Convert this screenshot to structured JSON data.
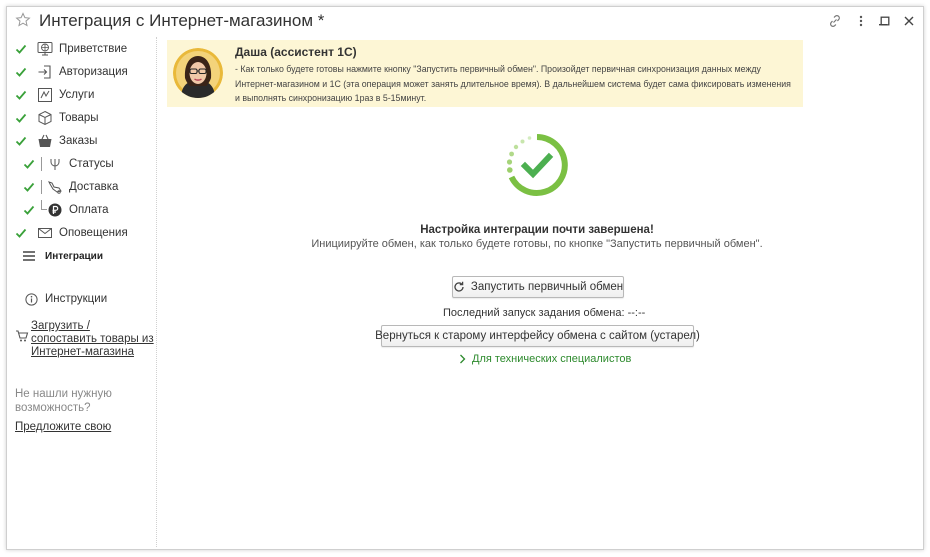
{
  "window": {
    "title": "Интеграция с Интернет-магазином *"
  },
  "sidebar": {
    "items": [
      {
        "label": "Приветствие",
        "icon": "globe-monitor-icon",
        "checked": true
      },
      {
        "label": "Авторизация",
        "icon": "login-icon",
        "checked": true
      },
      {
        "label": "Услуги",
        "icon": "services-icon",
        "checked": true
      },
      {
        "label": "Товары",
        "icon": "box-icon",
        "checked": true
      },
      {
        "label": "Заказы",
        "icon": "basket-icon",
        "checked": true
      },
      {
        "label": "Статусы",
        "icon": "fork-icon",
        "checked": true
      },
      {
        "label": "Доставка",
        "icon": "delivery-icon",
        "checked": true
      },
      {
        "label": "Оплата",
        "icon": "ruble-icon",
        "checked": true
      },
      {
        "label": "Оповещения",
        "icon": "envelope-icon",
        "checked": true
      },
      {
        "label": "Интеграции",
        "icon": "menu-icon",
        "checked": false
      }
    ],
    "instructions": "Инструкции",
    "load_link": [
      "Загрузить /",
      "сопоставить товары из",
      "Интернет-магазина"
    ],
    "not_found": [
      "Не нашли нужную",
      "возможность?"
    ],
    "suggest_link": "Предложите свою"
  },
  "assistant": {
    "name": "Даша (ассистент 1С)",
    "message": "- Как только будете готовы нажмите кнопку \"Запустить первичный обмен\". Произойдет первичная синхронизация данных между Интернет-магазином и 1С (эта операция может занять длительное время). В дальнейшем система будет сама фиксировать изменения и выполнять синхронизацию 1раз в 5-15минут."
  },
  "main": {
    "status_title": "Настройка интеграции почти завершена!",
    "status_subtitle": "Инициируйте обмен, как только будете готовы, по кнопке \"Запустить первичный обмен\".",
    "start_button": "Запустить первичный обмен",
    "last_run": "Последний запуск задания обмена: --:--",
    "old_interface_button": "Вернуться к старому интерфейсу обмена с сайтом (устарел)",
    "tech_link": "Для технических специалистов"
  },
  "colors": {
    "accent_green": "#4caf50",
    "check_green": "#3aa13a",
    "assistant_bg": "#fdf6d5",
    "link_green": "#2d8a2d"
  }
}
